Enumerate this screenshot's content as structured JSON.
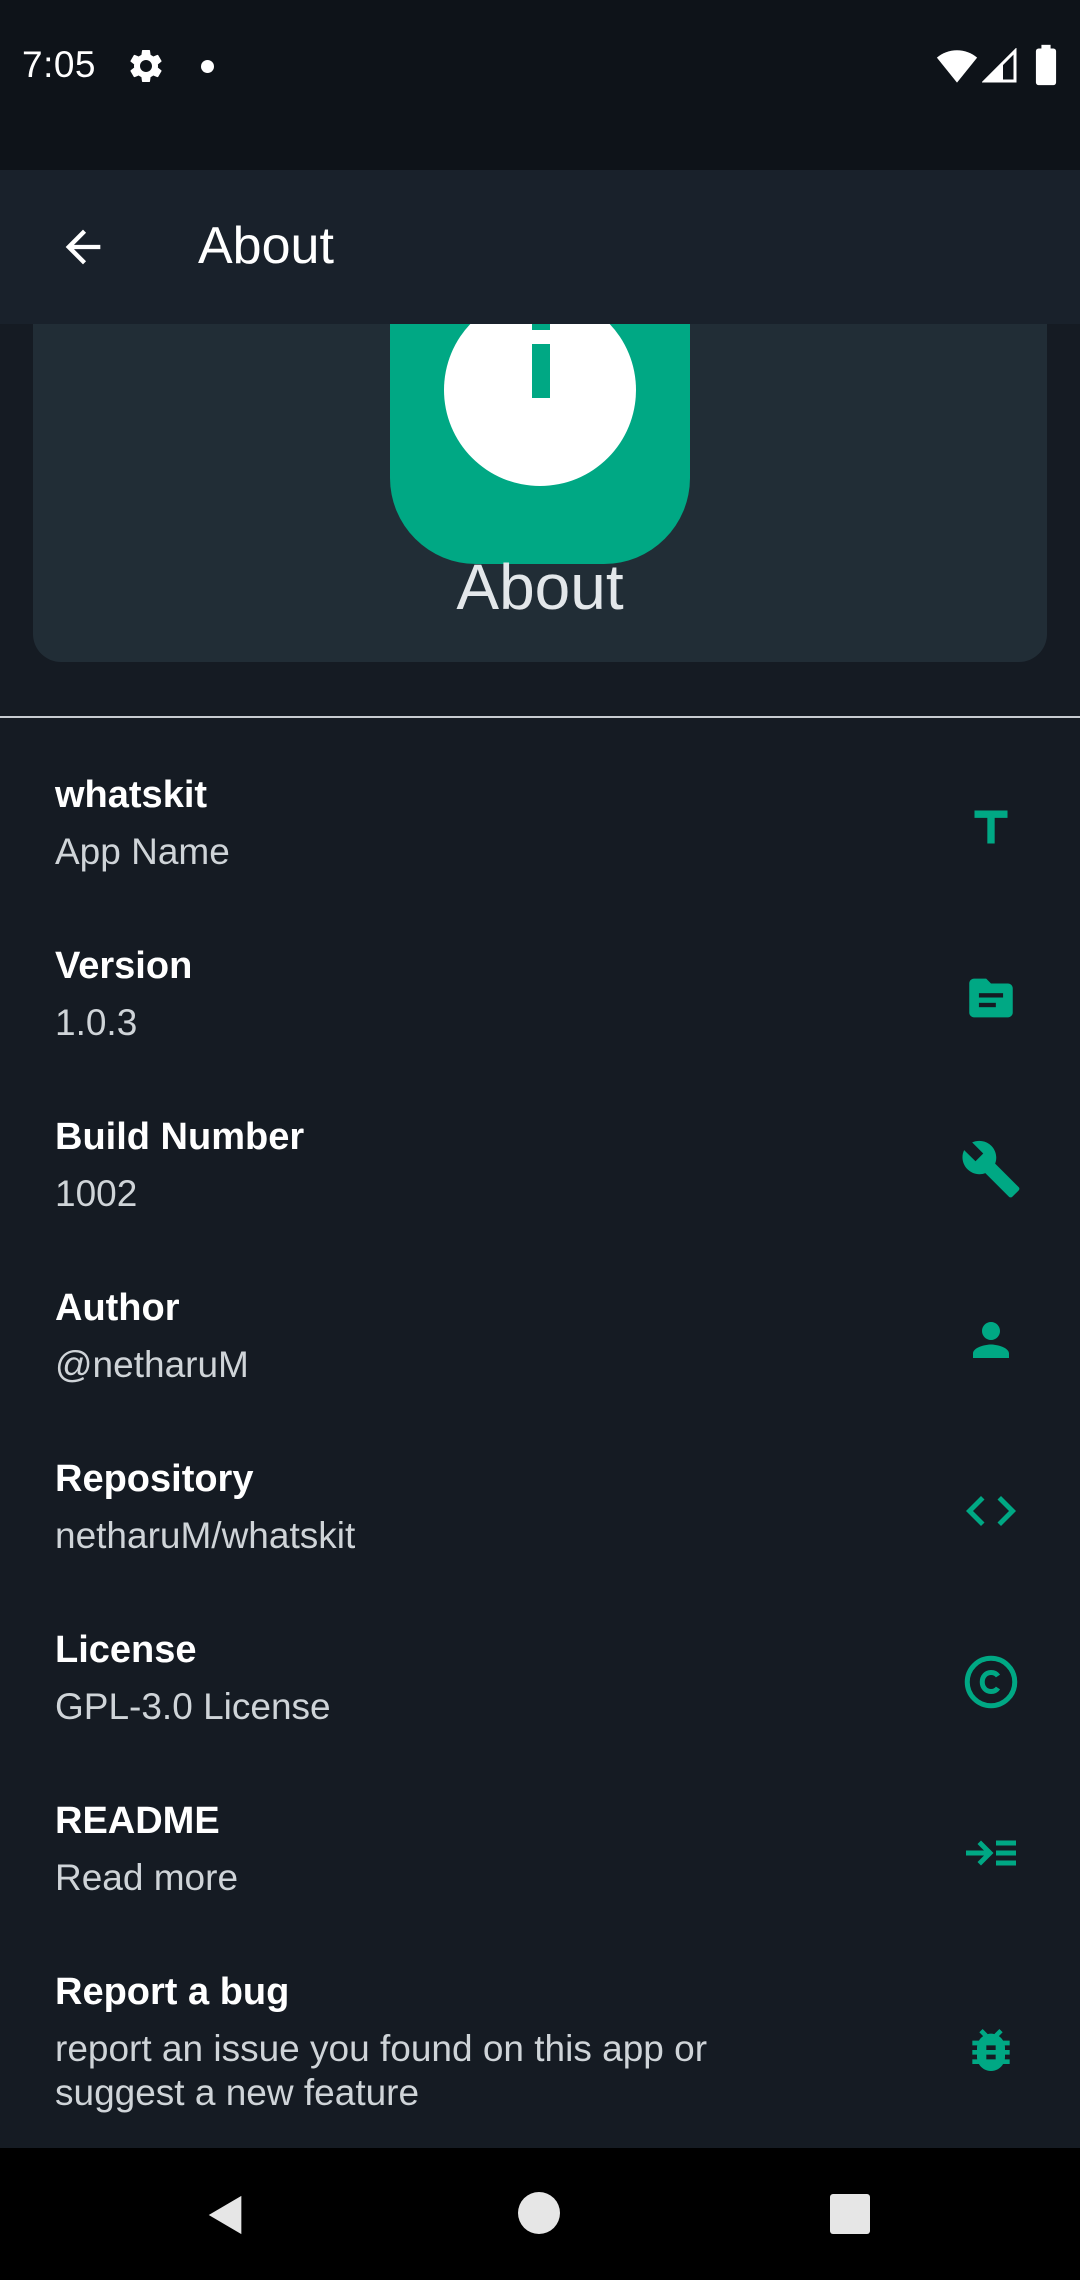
{
  "status_bar": {
    "time": "7:05",
    "icons": [
      "gear-icon",
      "notification-dot-icon",
      "wifi-icon",
      "signal-icon",
      "battery-icon"
    ]
  },
  "app_bar": {
    "back_icon": "arrow-left-icon",
    "title": "About"
  },
  "hero": {
    "icon": "info-icon",
    "title": "About"
  },
  "colors": {
    "accent": "#00a884",
    "background": "#151b23",
    "app_bar": "#19212b",
    "card": "#212d36"
  },
  "items": [
    {
      "title": "whatskit",
      "subtitle": "App Name",
      "icon": "text-t-icon"
    },
    {
      "title": "Version",
      "subtitle": "1.0.3",
      "icon": "article-icon"
    },
    {
      "title": "Build Number",
      "subtitle": "1002",
      "icon": "wrench-icon"
    },
    {
      "title": "Author",
      "subtitle": "@netharuM",
      "icon": "person-icon"
    },
    {
      "title": "Repository",
      "subtitle": "netharuM/whatskit",
      "icon": "code-icon"
    },
    {
      "title": "License",
      "subtitle": "GPL-3.0 License",
      "icon": "copyright-icon"
    },
    {
      "title": "README",
      "subtitle": "Read more",
      "icon": "format-indent-icon"
    },
    {
      "title": "Report a bug",
      "subtitle": "report an issue you found on this app or suggest a new feature",
      "icon": "bug-icon"
    }
  ],
  "nav_bar": {
    "icons": [
      "nav-back-icon",
      "nav-home-icon",
      "nav-recents-icon"
    ]
  }
}
